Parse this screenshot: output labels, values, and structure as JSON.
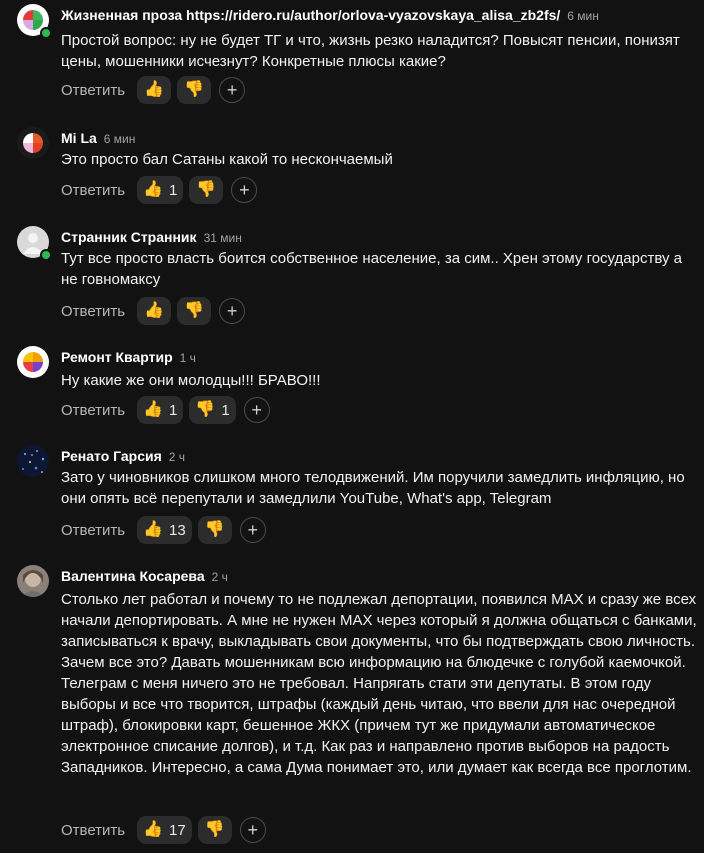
{
  "reply_label": "Ответить",
  "icons": {
    "like": "👍",
    "dislike": "👎",
    "add_reaction": "+"
  },
  "comments": [
    {
      "author": "Жизненная проза https://ridero.ru/author/orlova-vyazovskaya_alisa_zb2fs/",
      "time": "6 мин",
      "text": "Простой вопрос: ну не будет ТГ и что, жизнь резко наладится? Повысят пенсии, понизят цены, мошенники исчезнут? Конкретные плюсы какие?",
      "likes": "",
      "dislikes": "",
      "online": true
    },
    {
      "author": "Mi La",
      "time": "6 мин",
      "text": "Это просто бал Сатаны какой то несконча­емый",
      "likes": "1",
      "dislikes": "",
      "online": false
    },
    {
      "author": "Странник Странник",
      "time": "31 мин",
      "text": "Тут все просто власть боится собственное население, за сим.. Хрен этому государству а не говномаксу",
      "likes": "",
      "dislikes": "",
      "online": true
    },
    {
      "author": "Ремонт Квартир",
      "time": "1 ч",
      "text": "Ну какие же они молодцы!!! БРАВО!!!",
      "likes": "1",
      "dislikes": "1",
      "online": false
    },
    {
      "author": "Ренато Гарсия",
      "time": "2 ч",
      "text": "Зато у чиновников слишком много телодвижений. Им поручили замедлить инфляцию, но они опять всё перепутали и замедлили YouTube, What's app, Telegram",
      "likes": "13",
      "dislikes": "",
      "online": false
    },
    {
      "author": "Валентина Косарева",
      "time": "2 ч",
      "text": "Столько лет работал и почему то не подлежал депортации, появился МАХ и сразу же всех начали депортировать. А мне не нужен МАХ через который я должна общаться с банками, записываться к врачу, выкладывать свои документы, что бы подтверждать свою личность. Зачем все это? Давать мошенникам всю информацию на блюдечке с голубой каемочкой. Телеграм с меня ничего это не требовал. Напрягать стати эти депутаты. В этом году выборы и все что творится, штрафы (каждый день читаю, что ввели для нас очередной штраф), блокировки карт, бешенное ЖКХ (причем тут же придумали автоматическое электронное списание долгов), и т.д. Как раз и направлено против выборов на радость Западников. Интересно, а сама Дума понимает это, или думает как всегда все проглотим.",
      "likes": "17",
      "dislikes": "",
      "online": false
    }
  ]
}
